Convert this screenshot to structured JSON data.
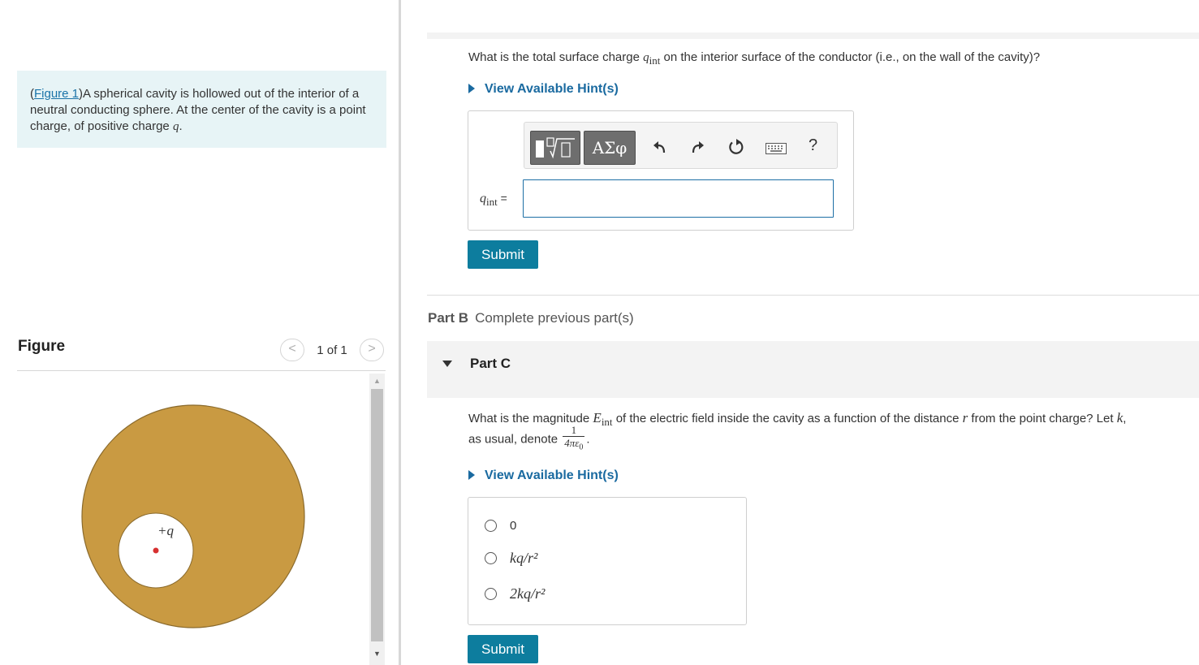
{
  "intro": {
    "figure_link": "Figure 1",
    "text_before": "(",
    "text_after": ")A spherical cavity is hollowed out of the interior of a neutral conducting sphere. At the center of the cavity is a point charge, of positive charge ",
    "charge_symbol": "q",
    "period": "."
  },
  "figure_panel": {
    "title": "Figure",
    "counter": "1 of 1",
    "prev_glyph": "<",
    "next_glyph": ">",
    "charge_label": "+q",
    "colors": {
      "conductor": "#c99a42",
      "conductor_edge": "#8a6a2c",
      "cavity": "#ffffff",
      "charge": "#d73030"
    }
  },
  "partA": {
    "question_before": "What is the total surface charge ",
    "question_symbol": "q",
    "question_sub": "int",
    "question_after": " on the interior surface of the conductor (i.e., on the wall of the cavity)?",
    "hint_label": "View Available Hint(s)",
    "toolbar": {
      "greek_label": "ΑΣφ",
      "help_label": "?"
    },
    "answer_symbol": "q",
    "answer_sub": "int",
    "answer_eq": " =",
    "answer_value": "",
    "submit_label": "Submit"
  },
  "partB": {
    "label": "Part B",
    "status": "Complete previous part(s)"
  },
  "partC": {
    "label": "Part C",
    "question_line1_a": "What is the magnitude ",
    "question_E": "E",
    "question_E_sub": "int",
    "question_line1_b": " of the electric field inside the cavity as a function of the distance ",
    "question_r": "r",
    "question_line1_c": " from the point charge? Let ",
    "question_k": "k",
    "question_line1_d": ",",
    "question_line2": "as usual, denote ",
    "frac_num": "1",
    "frac_den": "4πε",
    "frac_den_sub": "0",
    "question_end": ".",
    "hint_label": "View Available Hint(s)",
    "choices": [
      {
        "label": "0",
        "selected": false
      },
      {
        "label": "kq/r²",
        "selected": false
      },
      {
        "label": "2kq/r²",
        "selected": false
      }
    ],
    "submit_label": "Submit"
  },
  "colors": {
    "accent": "#0d7d9e",
    "link": "#1a6aa0",
    "intro_bg": "#e7f4f6"
  }
}
